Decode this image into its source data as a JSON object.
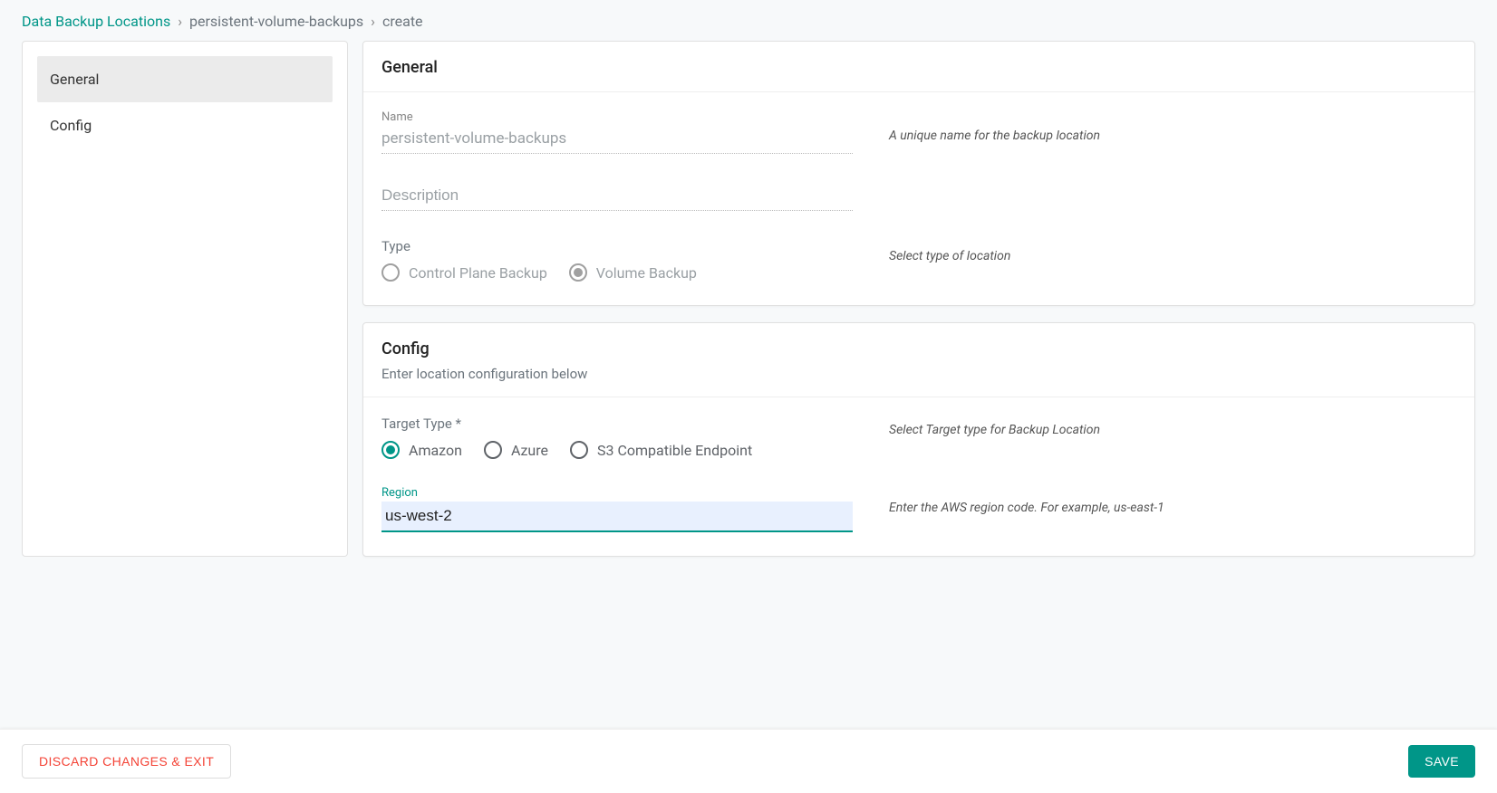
{
  "breadcrumb": {
    "root": "Data Backup Locations",
    "mid": "persistent-volume-backups",
    "last": "create"
  },
  "sidebar": {
    "items": [
      {
        "label": "General",
        "active": true
      },
      {
        "label": "Config",
        "active": false
      }
    ]
  },
  "general": {
    "title": "General",
    "name_label": "Name",
    "name_value": "persistent-volume-backups",
    "name_hint": "A unique name for the backup location",
    "description_placeholder": "Description",
    "type_label": "Type",
    "type_hint": "Select type of location",
    "type_options": {
      "control_plane": "Control Plane Backup",
      "volume": "Volume Backup"
    }
  },
  "config": {
    "title": "Config",
    "subtitle": "Enter location configuration below",
    "target_label": "Target Type *",
    "target_hint": "Select Target type for Backup Location",
    "target_options": {
      "amazon": "Amazon",
      "azure": "Azure",
      "s3": "S3 Compatible Endpoint"
    },
    "region_label": "Region",
    "region_value": "us-west-2",
    "region_hint": "Enter the AWS region code. For example, us-east-1"
  },
  "footer": {
    "discard": "DISCARD CHANGES & EXIT",
    "save": "SAVE"
  }
}
